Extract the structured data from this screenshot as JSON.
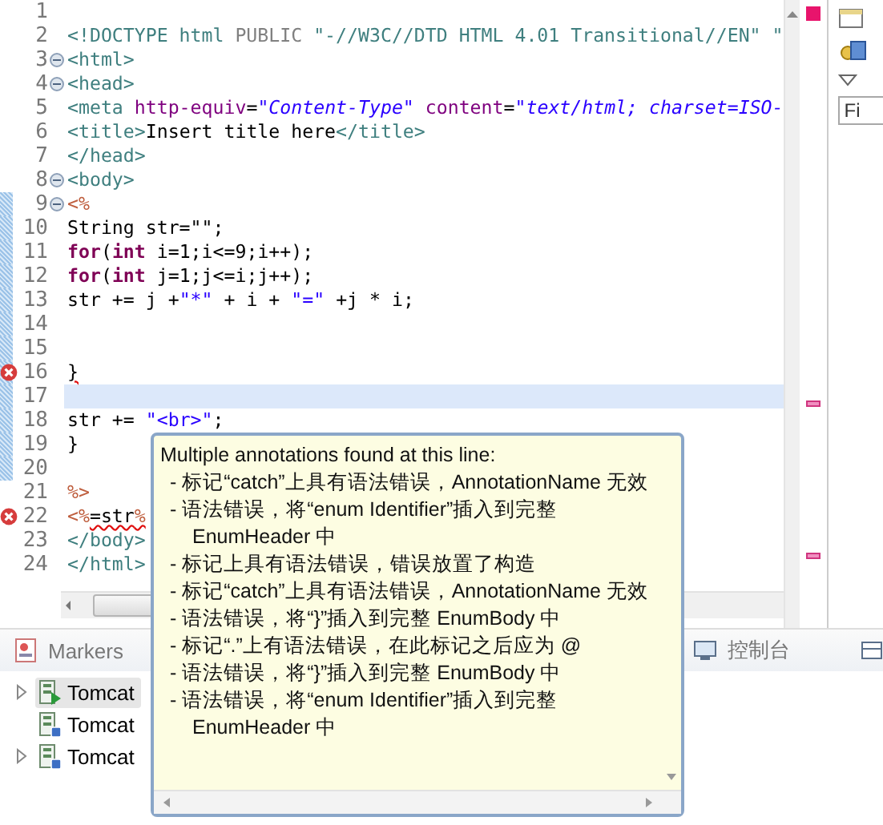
{
  "editor": {
    "lines": [
      {
        "number": "1",
        "current": false,
        "changed": false
      },
      {
        "number": "2",
        "current": false,
        "changed": false,
        "segments": [
          {
            "kind": "tag",
            "text": "<!DOCTYPE html "
          },
          {
            "kind": "doctype",
            "text": "PUBLIC "
          },
          {
            "kind": "doctype-string",
            "text": "\"-//W3C//DTD HTML 4.01 Transitional//EN\" \""
          }
        ]
      },
      {
        "number": "3",
        "current": false,
        "changed": false,
        "kind": "fold",
        "segments": [
          {
            "kind": "tag",
            "text": "<html>"
          }
        ]
      },
      {
        "number": "4",
        "current": false,
        "changed": false,
        "kind": "fold",
        "segments": [
          {
            "kind": "tag",
            "text": "<head>"
          }
        ]
      },
      {
        "number": "5",
        "current": false,
        "changed": false,
        "segments": [
          {
            "kind": "tag",
            "text": "<meta "
          },
          {
            "kind": "attr",
            "text": "http-equiv"
          },
          {
            "kind": "plain",
            "text": "="
          },
          {
            "kind": "value",
            "text": "\"Content-Type\" "
          },
          {
            "kind": "attr",
            "text": "content"
          },
          {
            "kind": "plain",
            "text": "="
          },
          {
            "kind": "value",
            "text": "\"text/html; charset=ISO-"
          }
        ]
      },
      {
        "number": "6",
        "current": false,
        "changed": false,
        "segments": [
          {
            "kind": "tag",
            "text": "<title>"
          },
          {
            "kind": "plain",
            "text": "Insert title here"
          },
          {
            "kind": "tag",
            "text": "</title>"
          }
        ]
      },
      {
        "number": "7",
        "current": false,
        "changed": false,
        "segments": [
          {
            "kind": "tag",
            "text": "</head>"
          }
        ]
      },
      {
        "number": "8",
        "current": false,
        "changed": false,
        "kind": "fold",
        "segments": [
          {
            "kind": "tag",
            "text": "<body>"
          }
        ]
      },
      {
        "number": "9",
        "current": false,
        "changed": true,
        "kind": "fold",
        "segments": [
          {
            "kind": "jsp",
            "text": "<%"
          }
        ]
      },
      {
        "number": "10",
        "current": false,
        "changed": true,
        "segments": [
          {
            "kind": "plain",
            "text": "String str=\"\";"
          }
        ]
      },
      {
        "number": "11",
        "current": false,
        "changed": true,
        "segments": [
          {
            "kind": "keyword",
            "text": "for"
          },
          {
            "kind": "plain",
            "text": "("
          },
          {
            "kind": "keyword",
            "text": "int"
          },
          {
            "kind": "plain",
            "text": " i=1;i<=9;i++);"
          }
        ]
      },
      {
        "number": "12",
        "current": false,
        "changed": true,
        "segments": [
          {
            "kind": "keyword",
            "text": "for"
          },
          {
            "kind": "plain",
            "text": "("
          },
          {
            "kind": "keyword",
            "text": "int"
          },
          {
            "kind": "plain",
            "text": " j=1;j<=i;j++);"
          }
        ]
      },
      {
        "number": "13",
        "current": false,
        "changed": true,
        "segments": [
          {
            "kind": "plain",
            "text": "str += j +"
          },
          {
            "kind": "string",
            "text": "\"*\""
          },
          {
            "kind": "plain",
            "text": " + i + "
          },
          {
            "kind": "string",
            "text": "\"=\""
          },
          {
            "kind": "plain",
            "text": " +j * i;"
          }
        ]
      },
      {
        "number": "14",
        "current": false,
        "changed": true
      },
      {
        "number": "15",
        "current": false,
        "changed": true
      },
      {
        "number": "16",
        "current": false,
        "changed": true,
        "kind": "error",
        "segments": [
          {
            "kind": "error",
            "text": "}"
          }
        ]
      },
      {
        "number": "17",
        "current": true,
        "changed": true
      },
      {
        "number": "18",
        "current": false,
        "changed": true,
        "segments": [
          {
            "kind": "plain",
            "text": "str += "
          },
          {
            "kind": "string",
            "text": "\"<br>\""
          },
          {
            "kind": "plain",
            "text": ";"
          }
        ]
      },
      {
        "number": "19",
        "current": false,
        "changed": true,
        "segments": [
          {
            "kind": "plain",
            "text": "}"
          }
        ]
      },
      {
        "number": "20",
        "current": false,
        "changed": true
      },
      {
        "number": "21",
        "current": false,
        "changed": false,
        "segments": [
          {
            "kind": "jsp",
            "text": "%>"
          }
        ]
      },
      {
        "number": "22",
        "current": false,
        "changed": false,
        "kind": "error",
        "segments": [
          {
            "kind": "jsp",
            "text": "<%"
          },
          {
            "kind": "error",
            "text": "=str"
          },
          {
            "kind": "jsp-error",
            "text": "%"
          }
        ]
      },
      {
        "number": "23",
        "current": false,
        "changed": false,
        "segments": [
          {
            "kind": "tag",
            "text": "</body>"
          }
        ]
      },
      {
        "number": "24",
        "current": false,
        "changed": false,
        "segments": [
          {
            "kind": "tag",
            "text": "</html>"
          }
        ]
      }
    ]
  },
  "right_panel": {
    "field": {
      "placeholder": "Fi"
    }
  },
  "bottom_panel": {
    "tabs": [
      {
        "label": "Markers",
        "selected": false
      },
      {
        "label": "控制台",
        "selected": false
      }
    ],
    "servers": [
      {
        "label": "Tomcat",
        "kind": "started",
        "expandable": true,
        "selected": true
      },
      {
        "label": "Tomcat",
        "kind": "stopped",
        "expandable": false,
        "selected": false
      },
      {
        "label": "Tomcat",
        "kind": "stopped",
        "expandable": true,
        "selected": false
      }
    ]
  },
  "tooltip": {
    "title": "Multiple annotations found at this line:",
    "items": [
      "- 标记“catch”上具有语法错误，AnnotationName 无效",
      "- 语法错误，将“enum Identifier”插入到完整 EnumHeader 中",
      "- 标记上具有语法错误，错误放置了构造",
      "- 标记“catch”上具有语法错误，AnnotationName 无效",
      "- 语法错误，将“}”插入到完整 EnumBody 中",
      "- 标记“.”上有语法错误，在此标记之后应为 @",
      "- 语法错误，将“}”插入到完整 EnumBody 中",
      "- 语法错误，将“enum Identifier”插入到完整 EnumHeader 中"
    ]
  }
}
